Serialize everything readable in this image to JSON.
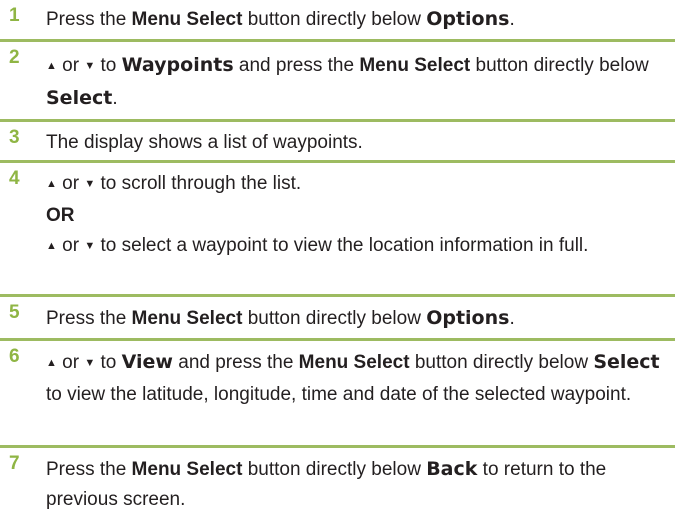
{
  "steps": [
    {
      "num": "1",
      "a": "Press the ",
      "b": "Menu Select",
      "c": " button directly below ",
      "d": "Options",
      "e": "."
    },
    {
      "num": "2",
      "or": " or ",
      "to": " to ",
      "ui1": "Waypoints",
      "mid": " and press the ",
      "b": "Menu Select",
      "c": " button directly below ",
      "ui2": "Select",
      "e": "."
    },
    {
      "num": "3",
      "text": "The display shows a list of waypoints."
    },
    {
      "num": "4",
      "or": " or ",
      "l1": " to scroll through the list.",
      "orword": "OR",
      "l2": " to select a waypoint to view the location information in full."
    },
    {
      "num": "5",
      "a": "Press the ",
      "b": "Menu Select",
      "c": " button directly below ",
      "d": "Options",
      "e": "."
    },
    {
      "num": "6",
      "or": " or ",
      "to": " to ",
      "ui1": "View",
      "mid": " and press the ",
      "b": "Menu Select",
      "c": " button directly below ",
      "ui2": "Select",
      "e": " to view the latitude, longitude, time and date of the selected waypoint."
    },
    {
      "num": "7",
      "a": "Press the ",
      "b": "Menu Select",
      "c": " button directly below ",
      "d": "Back",
      "e": " to return to the previous screen."
    }
  ],
  "icons": {
    "up": "▲",
    "down": "▼"
  }
}
